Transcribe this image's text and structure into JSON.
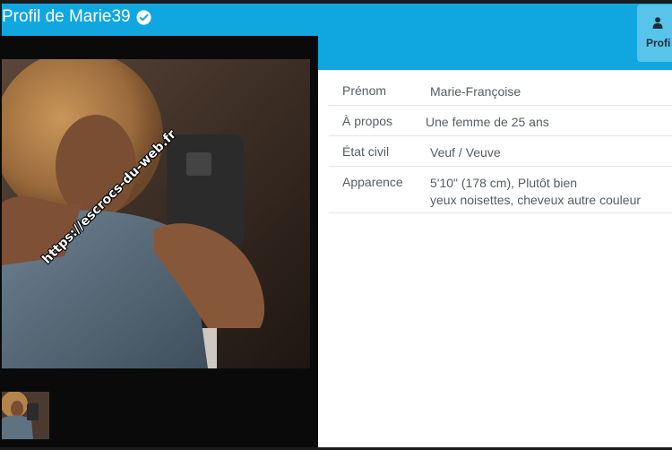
{
  "header": {
    "title": "Profil de Marie39",
    "verified_icon": "check-circle-icon",
    "background_color": "#10a7e0"
  },
  "profile_tab": {
    "label": "Profi",
    "icon": "user-icon"
  },
  "photo": {
    "watermark": "https://escrocs-du-web.fr"
  },
  "details": [
    {
      "label": "Prénom",
      "value": "Marie-Françoise"
    },
    {
      "label": "À propos",
      "value": "Une femme de 25 ans"
    },
    {
      "label": "État civil",
      "value": "Veuf / Veuve"
    },
    {
      "label": "Apparence",
      "value": "5'10\" (178 cm), Plutôt bien",
      "value2": "yeux noisettes, cheveux autre couleur"
    }
  ]
}
